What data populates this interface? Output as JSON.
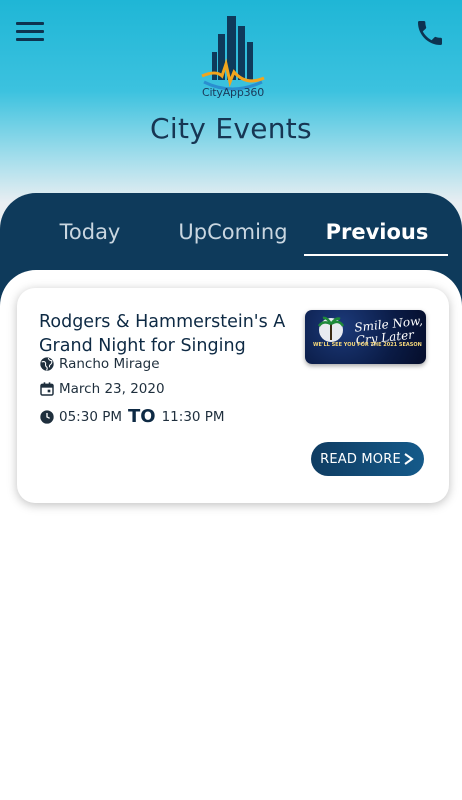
{
  "app": {
    "logo_text": "CityApp360",
    "title": "City Events"
  },
  "tabs": [
    {
      "label": "Today",
      "active": false
    },
    {
      "label": "UpComing",
      "active": false
    },
    {
      "label": "Previous",
      "active": true
    }
  ],
  "event": {
    "title": "Rodgers & Hammerstein's A Grand Night for Singing",
    "location": "Rancho Mirage",
    "date": "March 23, 2020",
    "start_time": "05:30 PM",
    "to_label": "TO",
    "end_time": "11:30 PM",
    "read_more_label": "READ MORE",
    "thumbnail": {
      "script_text": "Smile Now, Cry Later",
      "tagline": "WE'LL SEE YOU FOR THE 2021 SEASON"
    }
  },
  "icons": {
    "menu": "hamburger-menu-icon",
    "phone": "phone-icon",
    "location": "globe-icon",
    "date": "calendar-icon",
    "time": "clock-icon",
    "arrow": "chevron-right-icon"
  },
  "colors": {
    "primary": "#0e3a5b",
    "accent": "#1fb6d6",
    "text_dark": "#0e2a44"
  }
}
